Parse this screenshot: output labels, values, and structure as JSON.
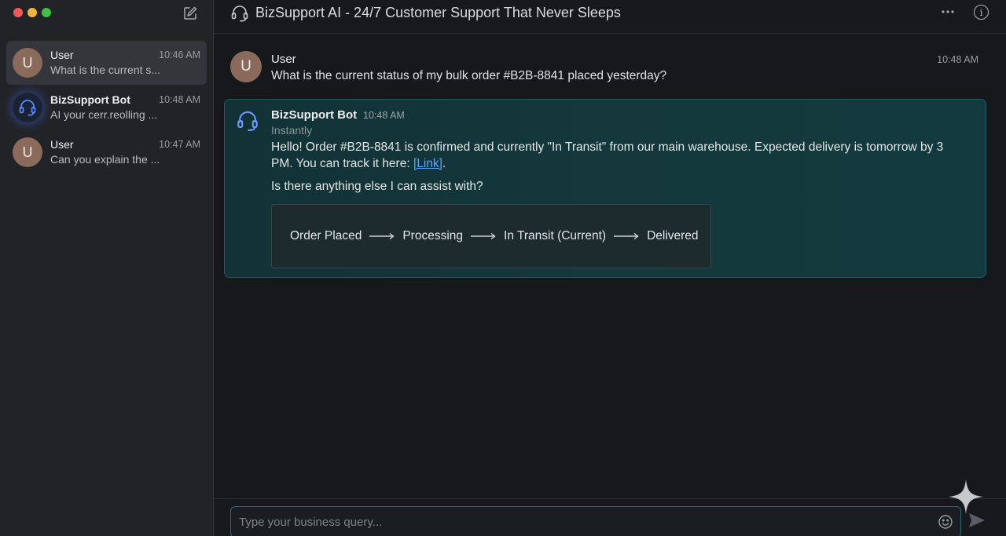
{
  "header": {
    "title": "BizSupport AI - 24/7 Customer Support That Never Sleeps",
    "icon": "headset-icon"
  },
  "sidebar": {
    "conversations": [
      {
        "avatar": "U",
        "name": "User",
        "time": "10:46 AM",
        "preview": "What is the current s...",
        "active": true
      },
      {
        "avatar": "headset",
        "name": "BizSupport Bot",
        "time": "10:48 AM",
        "preview": "AI your cerr.reolling ..."
      },
      {
        "avatar": "U",
        "name": "User",
        "time": "10:47 AM",
        "preview": "Can you explain the ..."
      }
    ]
  },
  "messages": {
    "user": {
      "avatar": "U",
      "name": "User",
      "time": "10:48 AM",
      "text": "What is the current status of my bulk order #B2B-8841 placed yesterday?"
    },
    "bot": {
      "name": "BizSupport Bot",
      "time": "10:48 AM",
      "subtitle": "Instantly",
      "body_prefix": "Hello! Order #B2B-8841 is confirmed and currently \"In Transit\" from our main warehouse. Expected delivery is tomorrow by 3 PM. You can track it here: ",
      "link_label": "[Link]",
      "body_suffix": ".",
      "question": "Is there anything else I can assist with?",
      "tracker": [
        "Order Placed",
        "Processing",
        "In Transit (Current)",
        "Delivered"
      ]
    }
  },
  "composer": {
    "placeholder": "Type your business query..."
  },
  "colors": {
    "accent_teal": "#1f5a5c",
    "link": "#5ea4ee",
    "user_avatar": "#8a6a5a"
  }
}
